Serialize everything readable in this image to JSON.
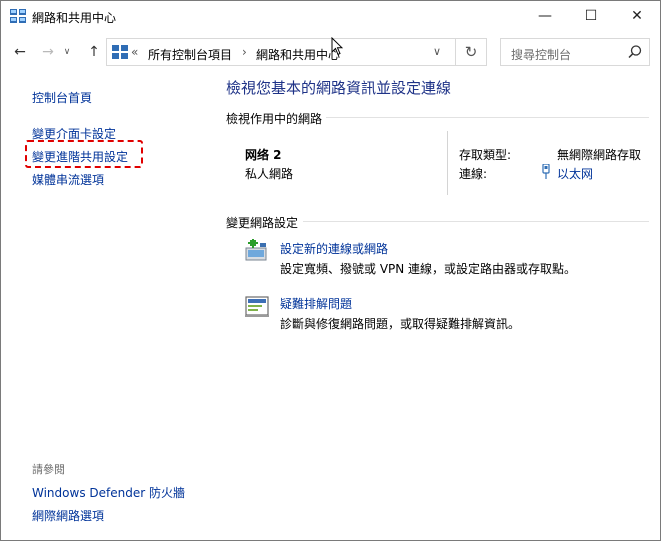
{
  "window": {
    "title": "網路和共用中心",
    "minimize_glyph": "—",
    "maximize_glyph": "☐",
    "close_glyph": "✕"
  },
  "nav": {
    "back_glyph": "←",
    "forward_glyph": "→",
    "recent_glyph": "∨",
    "up_glyph": "↑",
    "breadcrumb_overflow": "«",
    "breadcrumb": [
      "所有控制台項目",
      "網路和共用中心"
    ],
    "breadcrumb_sep": "›",
    "dropdown_glyph": "∨",
    "refresh_glyph": "↻",
    "search_placeholder": "搜尋控制台"
  },
  "sidebar": {
    "items": [
      {
        "label": "控制台首頁"
      },
      {
        "label": "變更介面卡設定"
      },
      {
        "label": "變更進階共用設定"
      },
      {
        "label": "媒體串流選項"
      }
    ],
    "see_also_label": "請參閱",
    "see_also": [
      {
        "label": "Windows Defender 防火牆"
      },
      {
        "label": "網際網路選項"
      }
    ]
  },
  "main": {
    "title": "檢視您基本的網路資訊並設定連線",
    "active_section": "檢視作用中的網路",
    "network": {
      "name": "网络 2",
      "category": "私人網路",
      "access_type_label": "存取類型:",
      "access_type_value": "無網際網路存取",
      "connections_label": "連線:",
      "connection_value": "以太网"
    },
    "change_section": "變更網路設定",
    "tasks": [
      {
        "label": "設定新的連線或網路",
        "description": "設定寬頻、撥號或 VPN 連線，或設定路由器或存取點。",
        "icon": "new-connection-icon"
      },
      {
        "label": "疑難排解問題",
        "description": "診斷與修復網路問題，或取得疑難排解資訊。",
        "icon": "troubleshoot-icon"
      }
    ]
  },
  "colors": {
    "link": "#003399",
    "title": "#1e3287",
    "highlight": "#e00000"
  }
}
